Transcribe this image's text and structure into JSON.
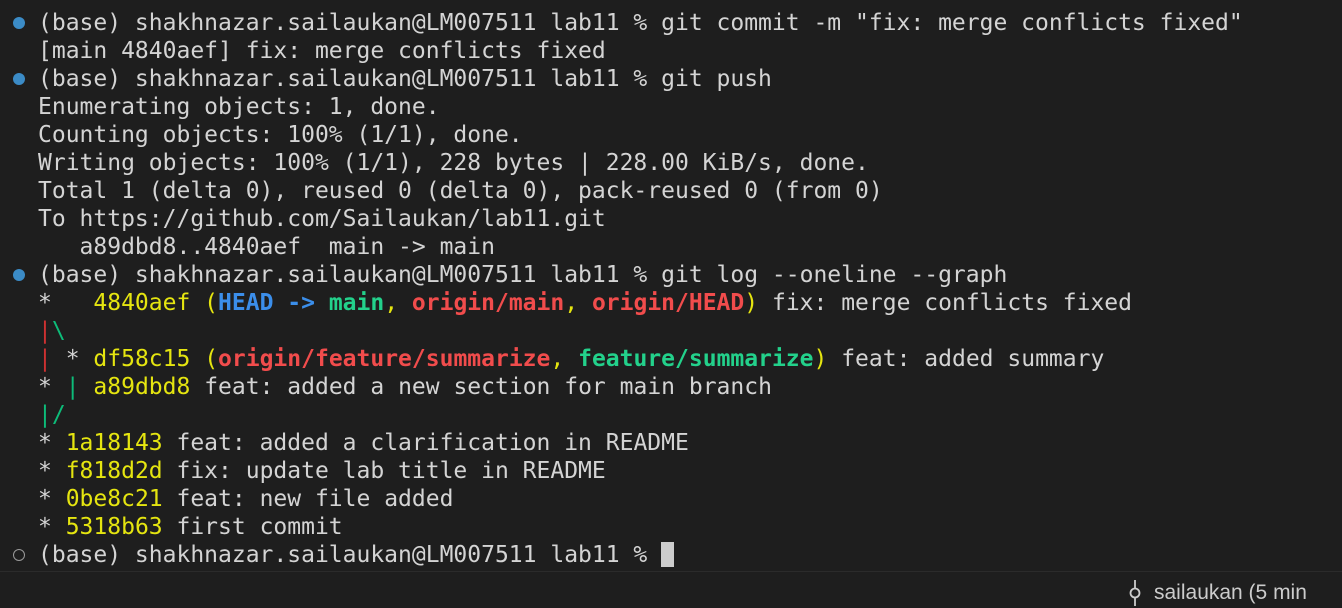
{
  "colors": {
    "background": "#1e1e1e",
    "default_text": "#d4d4d4",
    "commit_hash": "#e5e510",
    "head_ref": "#3b8eea",
    "local_branch": "#23d18b",
    "remote_branch": "#f14c4c",
    "graph_red": "#cd3131",
    "graph_green": "#0dbc79",
    "marker_done": "#3b8bc6"
  },
  "lines": [
    {
      "marker": "done",
      "segments": [
        {
          "text": "(base) shakhnazar.sailaukan@LM007511 lab11 % git commit -m \"fix: merge conflicts fixed\"",
          "color": "#d4d4d4"
        }
      ]
    },
    {
      "segments": [
        {
          "text": "[main 4840aef] fix: merge conflicts fixed",
          "color": "#d4d4d4"
        }
      ]
    },
    {
      "marker": "done",
      "segments": [
        {
          "text": "(base) shakhnazar.sailaukan@LM007511 lab11 % git push",
          "color": "#d4d4d4"
        }
      ]
    },
    {
      "segments": [
        {
          "text": "Enumerating objects: 1, done.",
          "color": "#d4d4d4"
        }
      ]
    },
    {
      "segments": [
        {
          "text": "Counting objects: 100% (1/1), done.",
          "color": "#d4d4d4"
        }
      ]
    },
    {
      "segments": [
        {
          "text": "Writing objects: 100% (1/1), 228 bytes | 228.00 KiB/s, done.",
          "color": "#d4d4d4"
        }
      ]
    },
    {
      "segments": [
        {
          "text": "Total 1 (delta 0), reused 0 (delta 0), pack-reused 0 (from 0)",
          "color": "#d4d4d4"
        }
      ]
    },
    {
      "segments": [
        {
          "text": "To https://github.com/Sailaukan/lab11.git",
          "color": "#d4d4d4"
        }
      ]
    },
    {
      "segments": [
        {
          "text": "   a89dbd8..4840aef  main -> main",
          "color": "#d4d4d4"
        }
      ]
    },
    {
      "marker": "done",
      "segments": [
        {
          "text": "(base) shakhnazar.sailaukan@LM007511 lab11 % git log --oneline --graph",
          "color": "#d4d4d4"
        }
      ]
    },
    {
      "segments": [
        {
          "text": "*   ",
          "color": "#d4d4d4"
        },
        {
          "text": "4840aef",
          "color": "#e5e510"
        },
        {
          "text": " (",
          "color": "#e5e510"
        },
        {
          "text": "HEAD -> ",
          "color": "#3b8eea",
          "bold": true
        },
        {
          "text": "main",
          "color": "#23d18b",
          "bold": true
        },
        {
          "text": ", ",
          "color": "#e5e510"
        },
        {
          "text": "origin/main",
          "color": "#f14c4c",
          "bold": true
        },
        {
          "text": ", ",
          "color": "#e5e510"
        },
        {
          "text": "origin/HEAD",
          "color": "#f14c4c",
          "bold": true
        },
        {
          "text": ")",
          "color": "#e5e510"
        },
        {
          "text": " fix: merge conflicts fixed",
          "color": "#d4d4d4"
        }
      ]
    },
    {
      "segments": [
        {
          "text": "|",
          "color": "#cd3131"
        },
        {
          "text": "\\",
          "color": "#0dbc79"
        }
      ]
    },
    {
      "segments": [
        {
          "text": "|",
          "color": "#cd3131"
        },
        {
          "text": " * ",
          "color": "#d4d4d4"
        },
        {
          "text": "df58c15",
          "color": "#e5e510"
        },
        {
          "text": " (",
          "color": "#e5e510"
        },
        {
          "text": "origin/feature/summarize",
          "color": "#f14c4c",
          "bold": true
        },
        {
          "text": ", ",
          "color": "#e5e510"
        },
        {
          "text": "feature/summarize",
          "color": "#23d18b",
          "bold": true
        },
        {
          "text": ")",
          "color": "#e5e510"
        },
        {
          "text": " feat: added summary",
          "color": "#d4d4d4"
        }
      ]
    },
    {
      "segments": [
        {
          "text": "* ",
          "color": "#d4d4d4"
        },
        {
          "text": "|",
          "color": "#0dbc79"
        },
        {
          "text": " ",
          "color": "#d4d4d4"
        },
        {
          "text": "a89dbd8",
          "color": "#e5e510"
        },
        {
          "text": " feat: added a new section for main branch",
          "color": "#d4d4d4"
        }
      ]
    },
    {
      "segments": [
        {
          "text": "|/",
          "color": "#0dbc79"
        }
      ]
    },
    {
      "segments": [
        {
          "text": "* ",
          "color": "#d4d4d4"
        },
        {
          "text": "1a18143",
          "color": "#e5e510"
        },
        {
          "text": " feat: added a clarification in README",
          "color": "#d4d4d4"
        }
      ]
    },
    {
      "segments": [
        {
          "text": "* ",
          "color": "#d4d4d4"
        },
        {
          "text": "f818d2d",
          "color": "#e5e510"
        },
        {
          "text": " fix: update lab title in README",
          "color": "#d4d4d4"
        }
      ]
    },
    {
      "segments": [
        {
          "text": "* ",
          "color": "#d4d4d4"
        },
        {
          "text": "0be8c21",
          "color": "#e5e510"
        },
        {
          "text": " feat: new file added",
          "color": "#d4d4d4"
        }
      ]
    },
    {
      "segments": [
        {
          "text": "* ",
          "color": "#d4d4d4"
        },
        {
          "text": "5318b63",
          "color": "#e5e510"
        },
        {
          "text": " first commit",
          "color": "#d4d4d4"
        }
      ]
    },
    {
      "marker": "pending",
      "cursor": true,
      "segments": [
        {
          "text": "(base) shakhnazar.sailaukan@LM007511 lab11 % ",
          "color": "#d4d4d4"
        }
      ]
    }
  ],
  "status_bar": {
    "icon": "git-commit-icon",
    "text": "sailaukan (5 min"
  }
}
